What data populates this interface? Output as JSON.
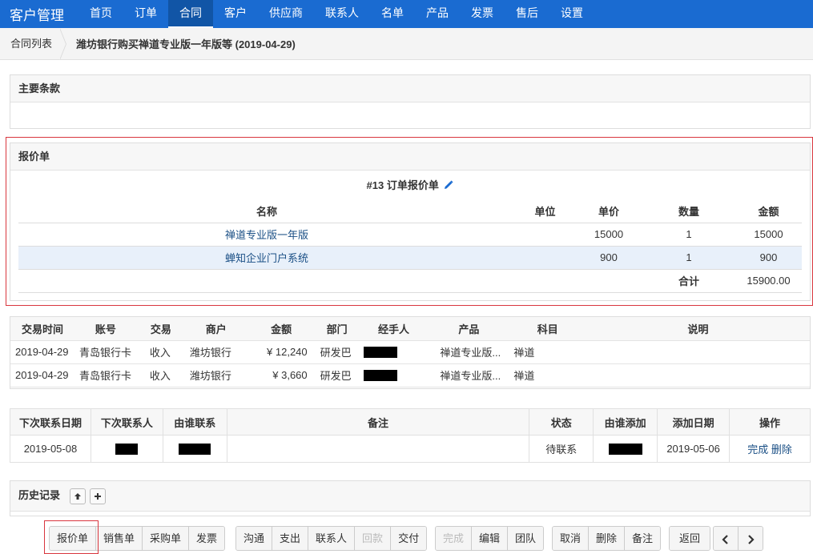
{
  "nav": {
    "brand": "客户管理",
    "items": [
      "首页",
      "订单",
      "合同",
      "客户",
      "供应商",
      "联系人",
      "名单",
      "产品",
      "发票",
      "售后",
      "设置"
    ],
    "active_index": 2
  },
  "breadcrumb": {
    "parent": "合同列表",
    "title": "潍坊银行购买禅道专业版一年版等 (2019-04-29)"
  },
  "main_terms": {
    "title": "主要条款"
  },
  "quote": {
    "title": "报价单",
    "order_title": "#13 订单报价单",
    "headers": {
      "name": "名称",
      "unit": "单位",
      "price": "单价",
      "qty": "数量",
      "amount": "金额"
    },
    "rows": [
      {
        "name": "禅道专业版一年版",
        "unit": "",
        "price": "15000",
        "qty": "1",
        "amount": "15000"
      },
      {
        "name": "蝉知企业门户系统",
        "unit": "",
        "price": "900",
        "qty": "1",
        "amount": "900"
      }
    ],
    "total_label": "合计",
    "total_value": "15900.00"
  },
  "transactions": {
    "headers": [
      "交易时间",
      "账号",
      "交易",
      "商户",
      "金额",
      "部门",
      "经手人",
      "产品",
      "科目",
      "说明"
    ],
    "rows": [
      {
        "date": "2019-04-29",
        "account": "青岛银行卡",
        "type": "收入",
        "merchant": "潍坊银行",
        "amount": "¥ 12,240",
        "dept": "研发巴",
        "product": "禅道专业版...",
        "subject": "禅道",
        "note": ""
      },
      {
        "date": "2019-04-29",
        "account": "青岛银行卡",
        "type": "收入",
        "merchant": "潍坊银行",
        "amount": "¥ 3,660",
        "dept": "研发巴",
        "product": "禅道专业版...",
        "subject": "禅道",
        "note": ""
      }
    ]
  },
  "contacts": {
    "headers": [
      "下次联系日期",
      "下次联系人",
      "由谁联系",
      "备注",
      "状态",
      "由谁添加",
      "添加日期",
      "操作"
    ],
    "rows": [
      {
        "next_date": "2019-05-08",
        "note": "",
        "status": "待联系",
        "added_date": "2019-05-06",
        "action_done": "完成",
        "action_delete": "删除"
      }
    ]
  },
  "history": {
    "title": "历史记录",
    "collapse_icon": "arrow-up-icon",
    "expand_icon": "plus-icon"
  },
  "toolbar": {
    "group1": [
      "报价单",
      "销售单",
      "采购单",
      "发票"
    ],
    "group2": [
      "沟通",
      "支出",
      "联系人",
      "回款",
      "交付"
    ],
    "group3": [
      "完成",
      "编辑",
      "团队"
    ],
    "group4": [
      "取消",
      "删除",
      "备注"
    ],
    "back": "返回"
  },
  "colors": {
    "nav_bg": "#1a6bd1",
    "link": "#1a4f85",
    "highlight_outline": "#d9363e",
    "row_highlight": "#e8f0fa"
  }
}
